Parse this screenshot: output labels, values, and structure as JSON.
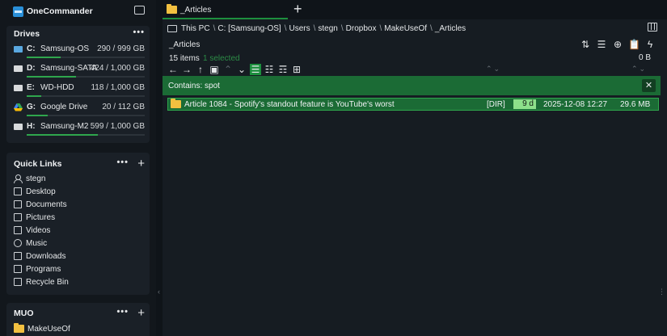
{
  "app": {
    "title": "OneCommander"
  },
  "drives": {
    "title": "Drives",
    "more": "•••",
    "items": [
      {
        "letter": "C:",
        "name": "Samsung-OS",
        "size": "290 / 999 GB",
        "used_fraction": 0.29,
        "icon": "os-drive-icon"
      },
      {
        "letter": "D:",
        "name": "Samsung-SATA",
        "size": "424 / 1,000 GB",
        "used_fraction": 0.42,
        "icon": "hdd-icon"
      },
      {
        "letter": "E:",
        "name": "WD-HDD",
        "size": "118 / 1,000 GB",
        "used_fraction": 0.12,
        "icon": "hdd-icon"
      },
      {
        "letter": "G:",
        "name": "Google Drive",
        "size": "20 / 112 GB",
        "used_fraction": 0.18,
        "icon": "google-drive-icon"
      },
      {
        "letter": "H:",
        "name": "Samsung-M2",
        "size": "599 / 1,000 GB",
        "used_fraction": 0.6,
        "icon": "hdd-icon"
      }
    ]
  },
  "quick_links": {
    "title": "Quick Links",
    "more": "•••",
    "add": "+",
    "items": [
      {
        "label": "stegn",
        "icon": "user-icon"
      },
      {
        "label": "Desktop",
        "icon": "desktop-icon"
      },
      {
        "label": "Documents",
        "icon": "documents-icon"
      },
      {
        "label": "Pictures",
        "icon": "pictures-icon"
      },
      {
        "label": "Videos",
        "icon": "videos-icon"
      },
      {
        "label": "Music",
        "icon": "music-icon"
      },
      {
        "label": "Downloads",
        "icon": "downloads-icon"
      },
      {
        "label": "Programs",
        "icon": "programs-icon"
      },
      {
        "label": "Recycle Bin",
        "icon": "recycle-bin-icon"
      }
    ]
  },
  "muo": {
    "title": "MUO",
    "more": "•••",
    "add": "+",
    "items": [
      {
        "label": "MakeUseOf",
        "icon": "folder-icon"
      }
    ]
  },
  "tabs": [
    {
      "label": "_Articles"
    }
  ],
  "tab_add": "+",
  "breadcrumb": [
    "This PC",
    "C: [Samsung-OS]",
    "Users",
    "stegn",
    "Dropbox",
    "MakeUseOf",
    "_Articles"
  ],
  "pane": {
    "folder_name": "_Articles",
    "items_count": "15 items",
    "selected_count": "1 selected",
    "size_total": "0 B"
  },
  "filter": {
    "text": "Contains: spot",
    "close": "✕"
  },
  "files": [
    {
      "name": "Article 1084 - Spotify's standout feature is YouTube's worst",
      "type": "[DIR]",
      "age": "9 d",
      "date": "2025-12-08",
      "time": "12:27",
      "size": "29.6 MB"
    }
  ],
  "colors": {
    "accent": "#1d8f3e",
    "selection": "#1b6b35",
    "age_badge": "#8de08a",
    "folder": "#f2c040"
  }
}
